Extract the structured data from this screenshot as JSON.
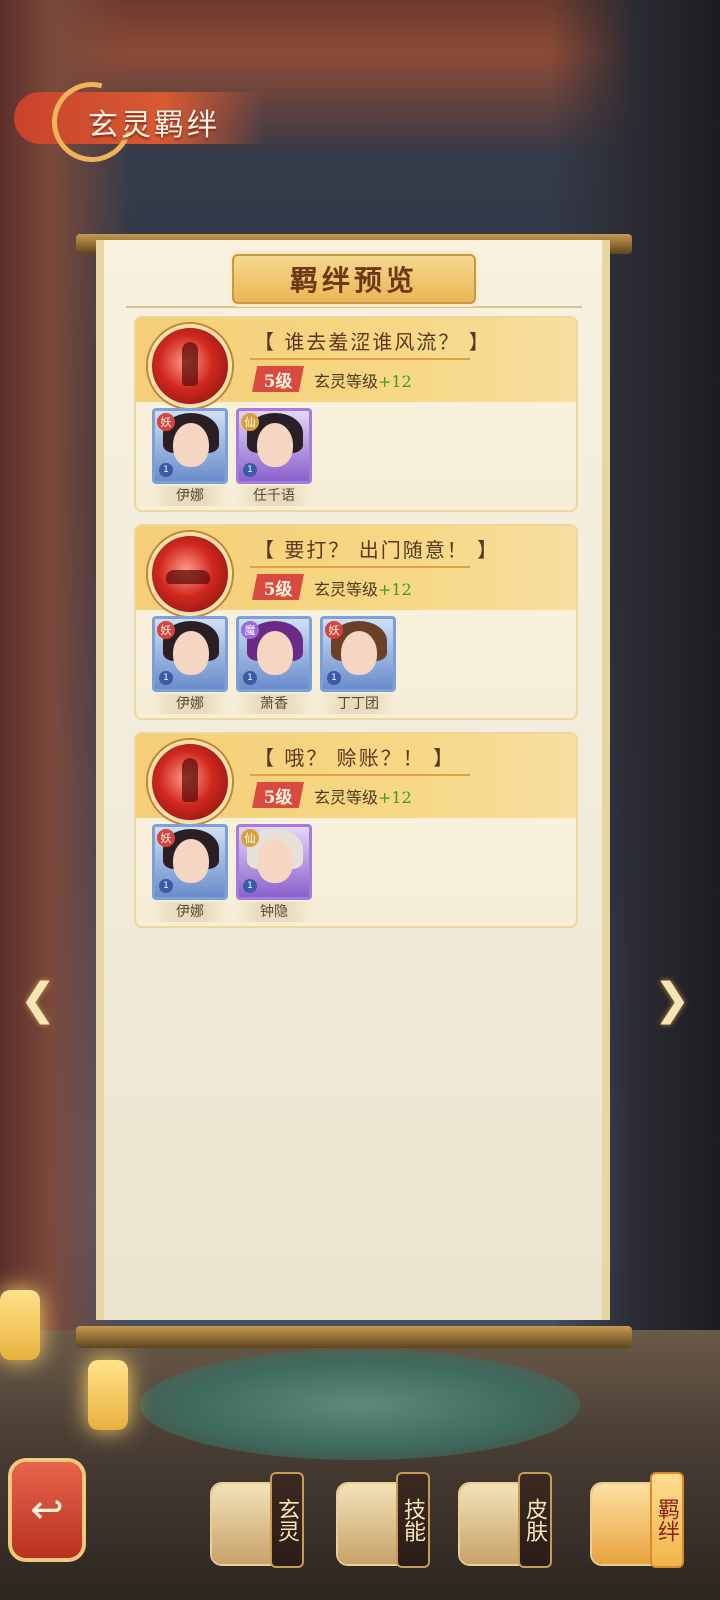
{
  "header": {
    "title": "玄灵羁绊"
  },
  "panel": {
    "title": "羁绊预览"
  },
  "bonds": [
    {
      "title": "【 谁去羞涩谁风流？ 】",
      "level": "5级",
      "level_label": "玄灵等级",
      "bonus": "+12",
      "heroes": [
        {
          "name": "伊娜",
          "rank": "妖",
          "star": "1",
          "portrait_icon": "hero-yina-portrait"
        },
        {
          "name": "任千语",
          "rank": "仙",
          "star": "1",
          "portrait_icon": "hero-renqianyu-portrait"
        }
      ]
    },
    {
      "title": "【 要打？ 出门随意！ 】",
      "level": "5级",
      "level_label": "玄灵等级",
      "bonus": "+12",
      "heroes": [
        {
          "name": "伊娜",
          "rank": "妖",
          "star": "1",
          "portrait_icon": "hero-yina-portrait"
        },
        {
          "name": "萧香",
          "rank": "魔",
          "star": "1",
          "portrait_icon": "hero-xiaoxiang-portrait"
        },
        {
          "name": "丁丁团",
          "rank": "妖",
          "star": "1",
          "portrait_icon": "hero-dingdingtuan-portrait"
        }
      ]
    },
    {
      "title": "【 哦？ 赊账？！ 】",
      "level": "5级",
      "level_label": "玄灵等级",
      "bonus": "+12",
      "heroes": [
        {
          "name": "伊娜",
          "rank": "妖",
          "star": "1",
          "portrait_icon": "hero-yina-portrait"
        },
        {
          "name": "钟隐",
          "rank": "仙",
          "star": "1",
          "portrait_icon": "hero-zhongyin-portrait"
        }
      ]
    }
  ],
  "navigation": {
    "prev_icon": "chevron-left-icon",
    "next_icon": "chevron-right-icon"
  },
  "bottom_tabs": [
    {
      "label": "玄灵",
      "icon": "xuanling-icon"
    },
    {
      "label": "技能",
      "icon": "skill-icon"
    },
    {
      "label": "皮肤",
      "icon": "skin-icon"
    },
    {
      "label": "羁绊",
      "icon": "bond-icon"
    }
  ],
  "colors": {
    "accent": "#d94b3e",
    "bonus": "#3e9b2d",
    "gold": "#eab655"
  }
}
